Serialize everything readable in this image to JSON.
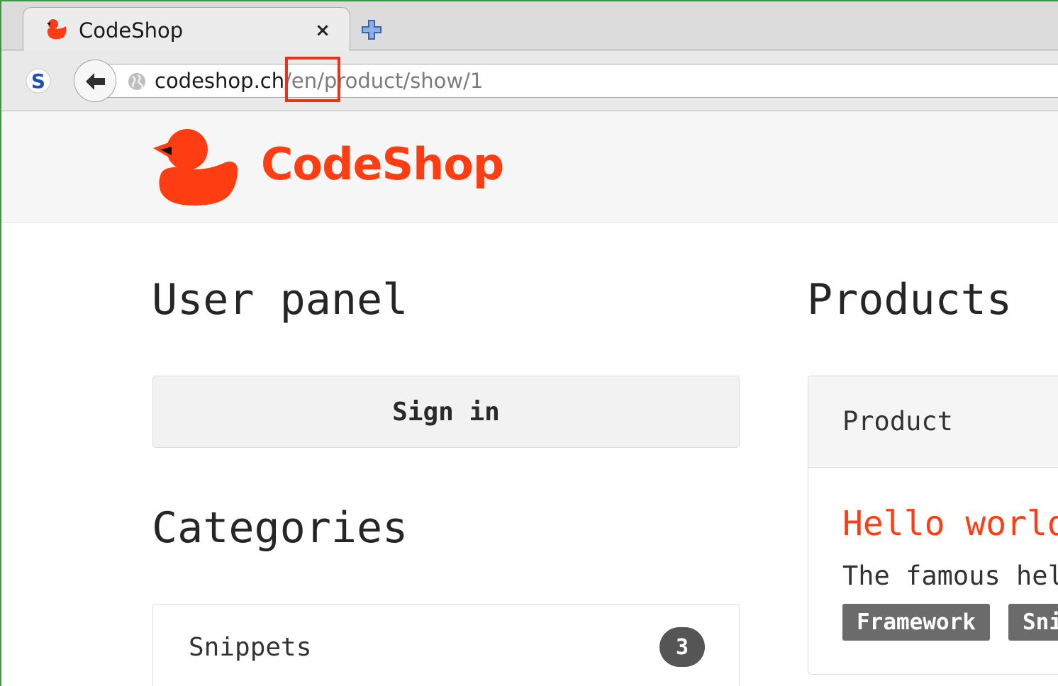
{
  "browser": {
    "tab_title": "CodeShop",
    "tab_close": "×",
    "url_host": "codeshop.ch",
    "url_path": "/en/product/show/1",
    "icons": [
      "duck-favicon-icon",
      "close-icon",
      "new-tab-icon",
      "extension-s-icon",
      "back-arrow-icon",
      "globe-icon"
    ]
  },
  "header": {
    "brand": "CodeShop",
    "brand_color": "#ff3d12"
  },
  "user_panel": {
    "heading": "User panel",
    "sign_in": "Sign in"
  },
  "categories": {
    "heading": "Categories",
    "items": [
      {
        "name": "Snippets",
        "count": "3"
      }
    ]
  },
  "products": {
    "heading": "Products",
    "card_header": "Product",
    "items": [
      {
        "title": "Hello world",
        "description": "The famous hello",
        "tags": [
          "Framework",
          "Snippets"
        ]
      }
    ]
  },
  "annotation": {
    "highlight_color": "#e8321a",
    "highlighted_text": "/en/"
  }
}
